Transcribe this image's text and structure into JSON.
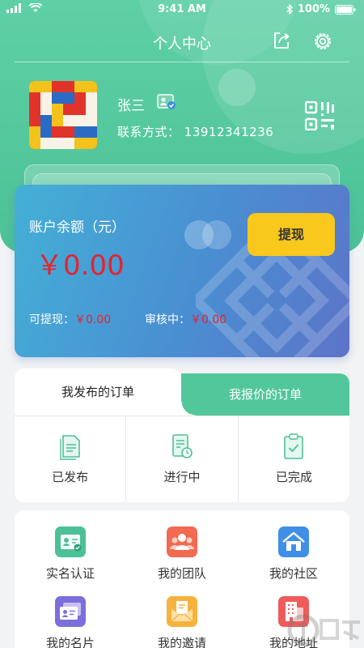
{
  "status_bar": {
    "time": "9:41 AM",
    "battery": "100%"
  },
  "header": {
    "title": "个人中心"
  },
  "user": {
    "name": "张三",
    "contact_label": "联系方式：",
    "phone": "13912341236"
  },
  "balance": {
    "label": "账户余额（元）",
    "amount": "￥0.00",
    "withdrawable_label": "可提现：",
    "withdrawable_value": "￥0.00",
    "reviewing_label": "审核中：",
    "reviewing_value": "￥0.00",
    "withdraw_button": "提现"
  },
  "orders": {
    "tabs": [
      "我发布的订单",
      "我报价的订单"
    ],
    "items": [
      "已发布",
      "进行中",
      "已完成"
    ]
  },
  "services": {
    "items": [
      {
        "label": "实名认证",
        "icon": "id-card-icon",
        "color": "#4cc196"
      },
      {
        "label": "我的团队",
        "icon": "team-icon",
        "color": "#f26a52"
      },
      {
        "label": "我的社区",
        "icon": "home-icon",
        "color": "#3f8fe6"
      },
      {
        "label": "我的名片",
        "icon": "business-card-icon",
        "color": "#7b6fdc"
      },
      {
        "label": "我的邀请",
        "icon": "envelope-icon",
        "color": "#f6b23c"
      },
      {
        "label": "我的地址",
        "icon": "building-icon",
        "color": "#ef5b5b"
      }
    ]
  },
  "colors": {
    "primary": "#4cc196",
    "amount_red": "#e4232f",
    "button_yellow": "#f9c81c"
  }
}
